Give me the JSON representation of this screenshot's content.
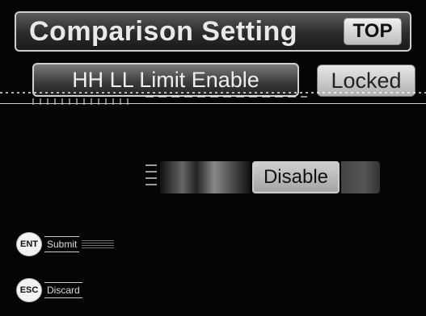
{
  "header": {
    "title": "Comparison Setting",
    "top_label": "TOP"
  },
  "settings": {
    "limit_label": "HH LL Limit Enable",
    "locked_label": "Locked"
  },
  "toggle": {
    "value_label": "Disable"
  },
  "keys": {
    "enter": {
      "key": "ENT",
      "label": "Submit"
    },
    "esc": {
      "key": "ESC",
      "label": "Discard"
    }
  },
  "colors": {
    "background": "#050505",
    "panel_border": "#cfcfcf",
    "text_light": "#e9e9e9"
  }
}
